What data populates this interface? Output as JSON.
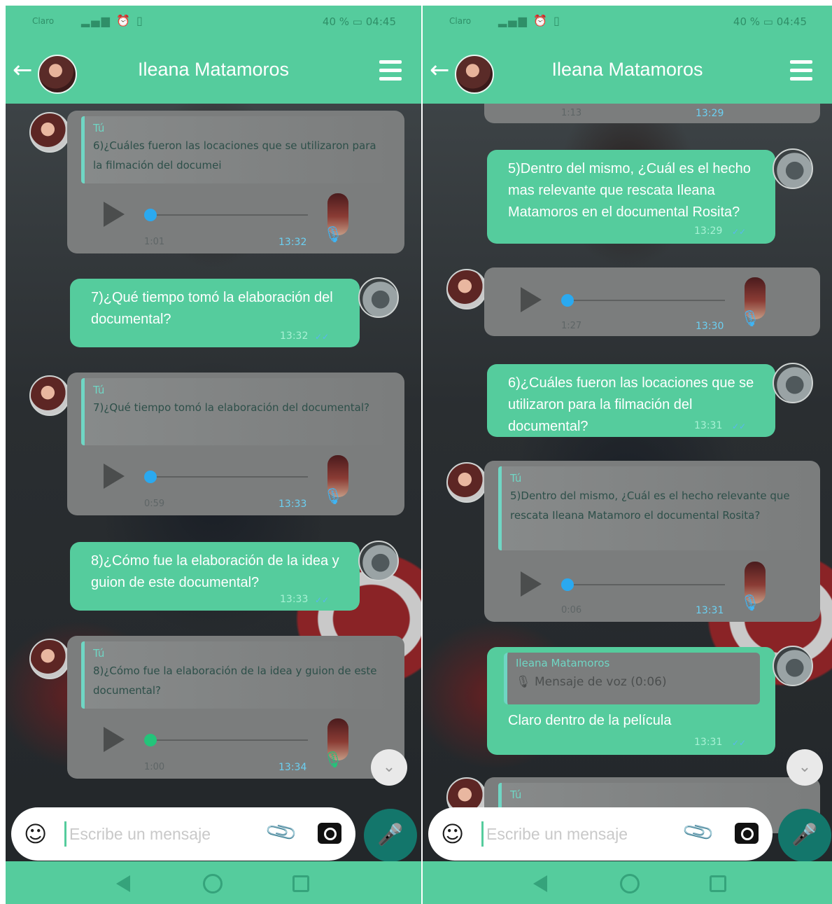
{
  "status_bar": {
    "carrier": "Claro",
    "battery": "40 %",
    "time": "04:45"
  },
  "header": {
    "contact_name": "Ileana Matamoros"
  },
  "left_screen": {
    "messages": [
      {
        "type": "voice_reply",
        "quote_author": "Tú",
        "quote_text": "6)¿Cuáles fueron las locaciones que se utilizaron para la filmación del documei",
        "duration": "1:01",
        "time": "13:32",
        "progress": 0
      },
      {
        "type": "outgoing_text",
        "text": "7)¿Qué tiempo tomó la elaboración del documental?",
        "time": "13:32"
      },
      {
        "type": "voice_reply",
        "quote_author": "Tú",
        "quote_text": "7)¿Qué tiempo tomó la elaboración del documental?",
        "duration": "0:59",
        "time": "13:33",
        "progress": 0
      },
      {
        "type": "outgoing_text",
        "text": "8)¿Cómo fue la elaboración de la idea y guion de este documental?",
        "time": "13:33"
      },
      {
        "type": "voice_reply",
        "quote_author": "Tú",
        "quote_text": "8)¿Cómo fue la elaboración de la idea y guion de este documental?",
        "duration": "1:00",
        "time": "13:34",
        "progress": 0
      }
    ]
  },
  "right_screen": {
    "messages": [
      {
        "type": "voice_partial",
        "duration": "1:13",
        "time": "13:29"
      },
      {
        "type": "outgoing_text",
        "text": "5)Dentro del mismo, ¿Cuál es el hecho mas relevante que rescata Ileana Matamoros en el documental Rosita?",
        "time": "13:29"
      },
      {
        "type": "voice",
        "duration": "1:27",
        "time": "13:30",
        "progress": 0
      },
      {
        "type": "outgoing_text",
        "text": "6)¿Cuáles fueron las locaciones que se utilizaron para la filmación del documental?",
        "time": "13:31"
      },
      {
        "type": "voice_reply",
        "quote_author": "Tú",
        "quote_text": "5)Dentro del mismo, ¿Cuál es el hecho relevante que rescata Ileana Matamoro el documental Rosita?",
        "duration": "0:06",
        "time": "13:31",
        "progress": 0
      },
      {
        "type": "outgoing_reply",
        "reply_author": "Ileana Matamoros",
        "reply_text": "🎙 Mensaje de voz (0:06)",
        "text": "Claro dentro de la película",
        "time": "13:31"
      },
      {
        "type": "voice_reply_partial",
        "quote_author": "Tú"
      }
    ]
  },
  "input_bar": {
    "placeholder": "Escribe un mensaje"
  },
  "icons": {
    "back": "arrow-left-icon",
    "menu": "hamburger-menu-icon",
    "emoji": "smiley-icon",
    "attach": "paperclip-icon",
    "camera": "camera-icon",
    "mic": "microphone-icon",
    "play": "play-icon",
    "scroll_down": "double-chevron-down-icon"
  },
  "colors": {
    "brand": "#55cc9d",
    "incoming_bubble": "#7b7d7d",
    "voice_button": "#13766b"
  }
}
